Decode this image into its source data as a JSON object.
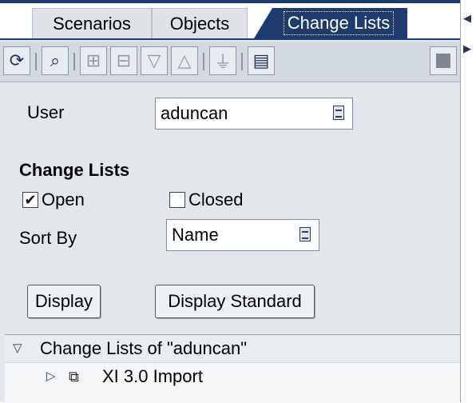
{
  "tabs": [
    {
      "label": "Scenarios"
    },
    {
      "label": "Objects"
    },
    {
      "label": "Change Lists"
    }
  ],
  "toolbar": {
    "buttons": [
      "refresh-icon",
      "find-icon",
      "expand-tree-icon",
      "collapse-tree-icon",
      "expand-all-icon",
      "collapse-all-icon",
      "filter-icon",
      "settings-icon",
      "stop-icon"
    ]
  },
  "form": {
    "user_label": "User",
    "user_value": "aduncan",
    "section_title": "Change Lists",
    "open_label": "Open",
    "open_checked": true,
    "closed_label": "Closed",
    "closed_checked": false,
    "sortby_label": "Sort By",
    "sortby_value": "Name",
    "display_button": "Display",
    "display_standard_button": "Display Standard"
  },
  "tree": {
    "root_label": "Change Lists of \"aduncan\"",
    "child_label": "XI 3.0 Import"
  },
  "colors": {
    "accent": "#1f3b6e",
    "panel": "#e3e7ec"
  }
}
